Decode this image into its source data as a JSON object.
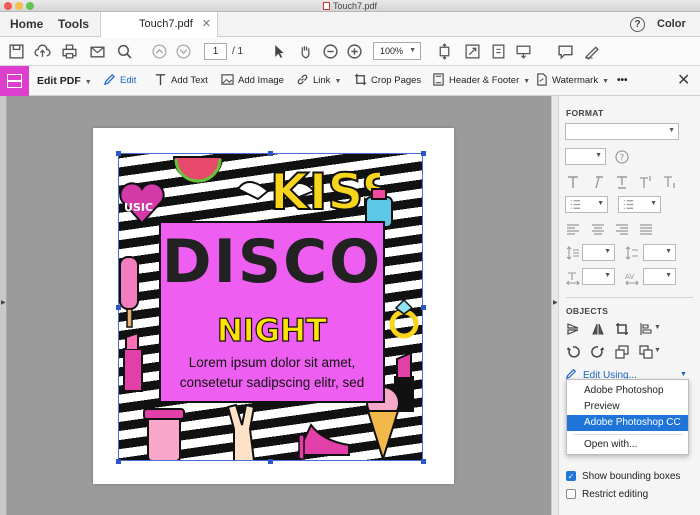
{
  "window": {
    "title": "Touch7.pdf"
  },
  "tabs": {
    "home": "Home",
    "tools": "Tools",
    "document": "Touch7.pdf",
    "color": "Color"
  },
  "toolbar": {
    "page_current": "1",
    "page_total": "/ 1",
    "zoom": "100%"
  },
  "edit_toolbar": {
    "title": "Edit PDF",
    "items": [
      "Edit",
      "Add Text",
      "Add Image",
      "Link",
      "Crop Pages",
      "Header & Footer",
      "Watermark"
    ],
    "more": "•••",
    "close": "✕"
  },
  "document": {
    "headline": "DISCO",
    "subheadline": "NIGHT",
    "body_line1": "Lorem ipsum dolor sit amet,",
    "body_line2": "consetetur sadipscing elitr, sed",
    "sticker_text": "KISS",
    "heart_text": "USIC"
  },
  "panel": {
    "format_title": "FORMAT",
    "objects_title": "OBJECTS",
    "edit_using": "Edit Using...",
    "edit_using_options": [
      "Adobe Photoshop",
      "Preview",
      "Adobe Photoshop CC",
      "Open with..."
    ],
    "selected_option": "Adobe Photoshop CC",
    "show_bounding_boxes": "Show bounding boxes",
    "restrict_editing": "Restrict editing",
    "show_bounding_boxes_checked": true,
    "restrict_editing_checked": false
  },
  "colors": {
    "accent": "#1f74d8",
    "edit_pdf": "#dc3fcd",
    "poster_pink": "#ee5ef0",
    "night_yellow": "#ffe400"
  }
}
